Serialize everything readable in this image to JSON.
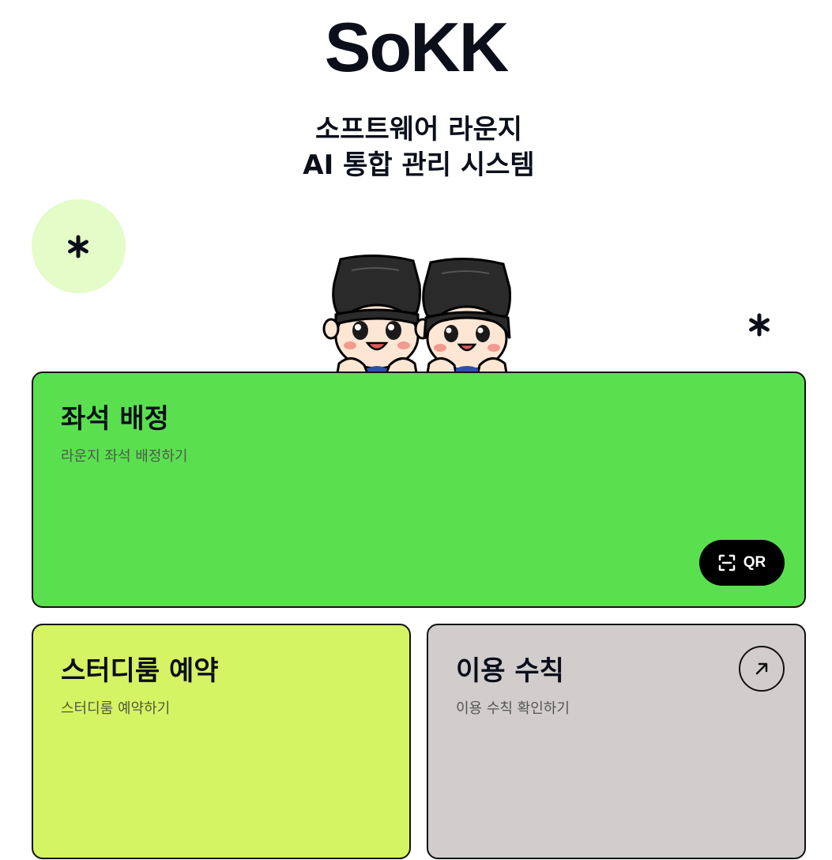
{
  "header": {
    "logo": "SoKK",
    "subtitle_line1": "소프트웨어 라운지",
    "subtitle_line2": "AI 통합 관리 시스템"
  },
  "decorations": {
    "circle_color": "#e3fcc8",
    "asterisk_icon": "asterisk-icon",
    "mascot": "mascot-illustration"
  },
  "cards": {
    "seat": {
      "title": "좌석 배정",
      "description": "라운지 좌석 배정하기",
      "color": "#5ae04f",
      "qr_label": "QR",
      "qr_icon": "qr-scan-icon"
    },
    "study": {
      "title": "스터디룸 예약",
      "description": "스터디룸 예약하기",
      "color": "#d4f464"
    },
    "rules": {
      "title": "이용 수칙",
      "description": "이용 수칙 확인하기",
      "color": "#d1cdcd",
      "arrow_icon": "arrow-up-right-icon"
    }
  }
}
